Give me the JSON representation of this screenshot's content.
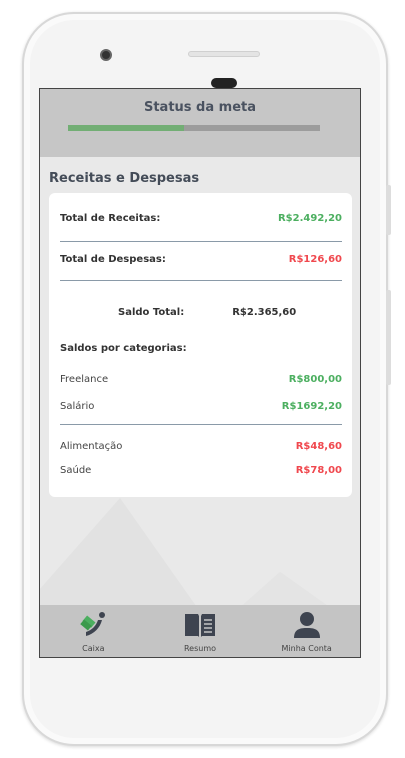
{
  "status": {
    "title": "Status da meta",
    "progress_fraction": 0.46
  },
  "section_title": "Receitas e Despesas",
  "summary": {
    "receitas_label": "Total de Receitas:",
    "receitas_value": "R$2.492,20",
    "despesas_label": "Total de Despesas:",
    "despesas_value": "R$126,60",
    "saldo_label": "Saldo Total:",
    "saldo_value": "R$2.365,60"
  },
  "categories_title": "Saldos por categorias:",
  "income_categories": [
    {
      "name": "Freelance",
      "value": "R$800,00"
    },
    {
      "name": "Salário",
      "value": "R$1692,20"
    }
  ],
  "expense_categories": [
    {
      "name": "Alimentação",
      "value": "R$48,60"
    },
    {
      "name": "Saúde",
      "value": "R$78,00"
    }
  ],
  "nav": [
    {
      "label": "Caixa",
      "icon": "money-hand-icon"
    },
    {
      "label": "Resumo",
      "icon": "book-icon"
    },
    {
      "label": "Minha Conta",
      "icon": "user-icon"
    }
  ],
  "colors": {
    "income": "#4caf60",
    "expense": "#f0484e",
    "progress": "#72ae74"
  }
}
